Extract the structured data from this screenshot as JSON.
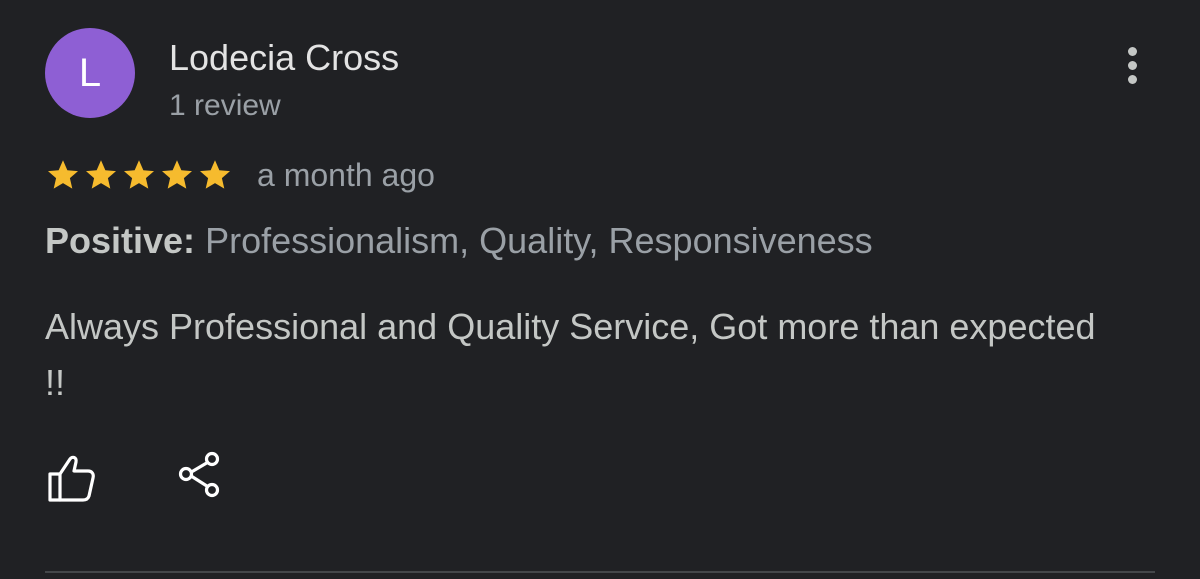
{
  "review": {
    "avatar_letter": "L",
    "avatar_color": "#8e5fd4",
    "reviewer_name": "Lodecia Cross",
    "review_count": "1 review",
    "rating": 5,
    "rating_max": 5,
    "star_color": "#f6bb2e",
    "date": "a month ago",
    "highlights_label": "Positive:",
    "highlights_values": "Professionalism, Quality, Responsiveness",
    "text": "Always Professional and Quality Service, Got more than expected !!"
  },
  "actions": {
    "more_icon": "more-vert-icon",
    "like_icon": "thumbs-up-icon",
    "share_icon": "share-icon"
  }
}
